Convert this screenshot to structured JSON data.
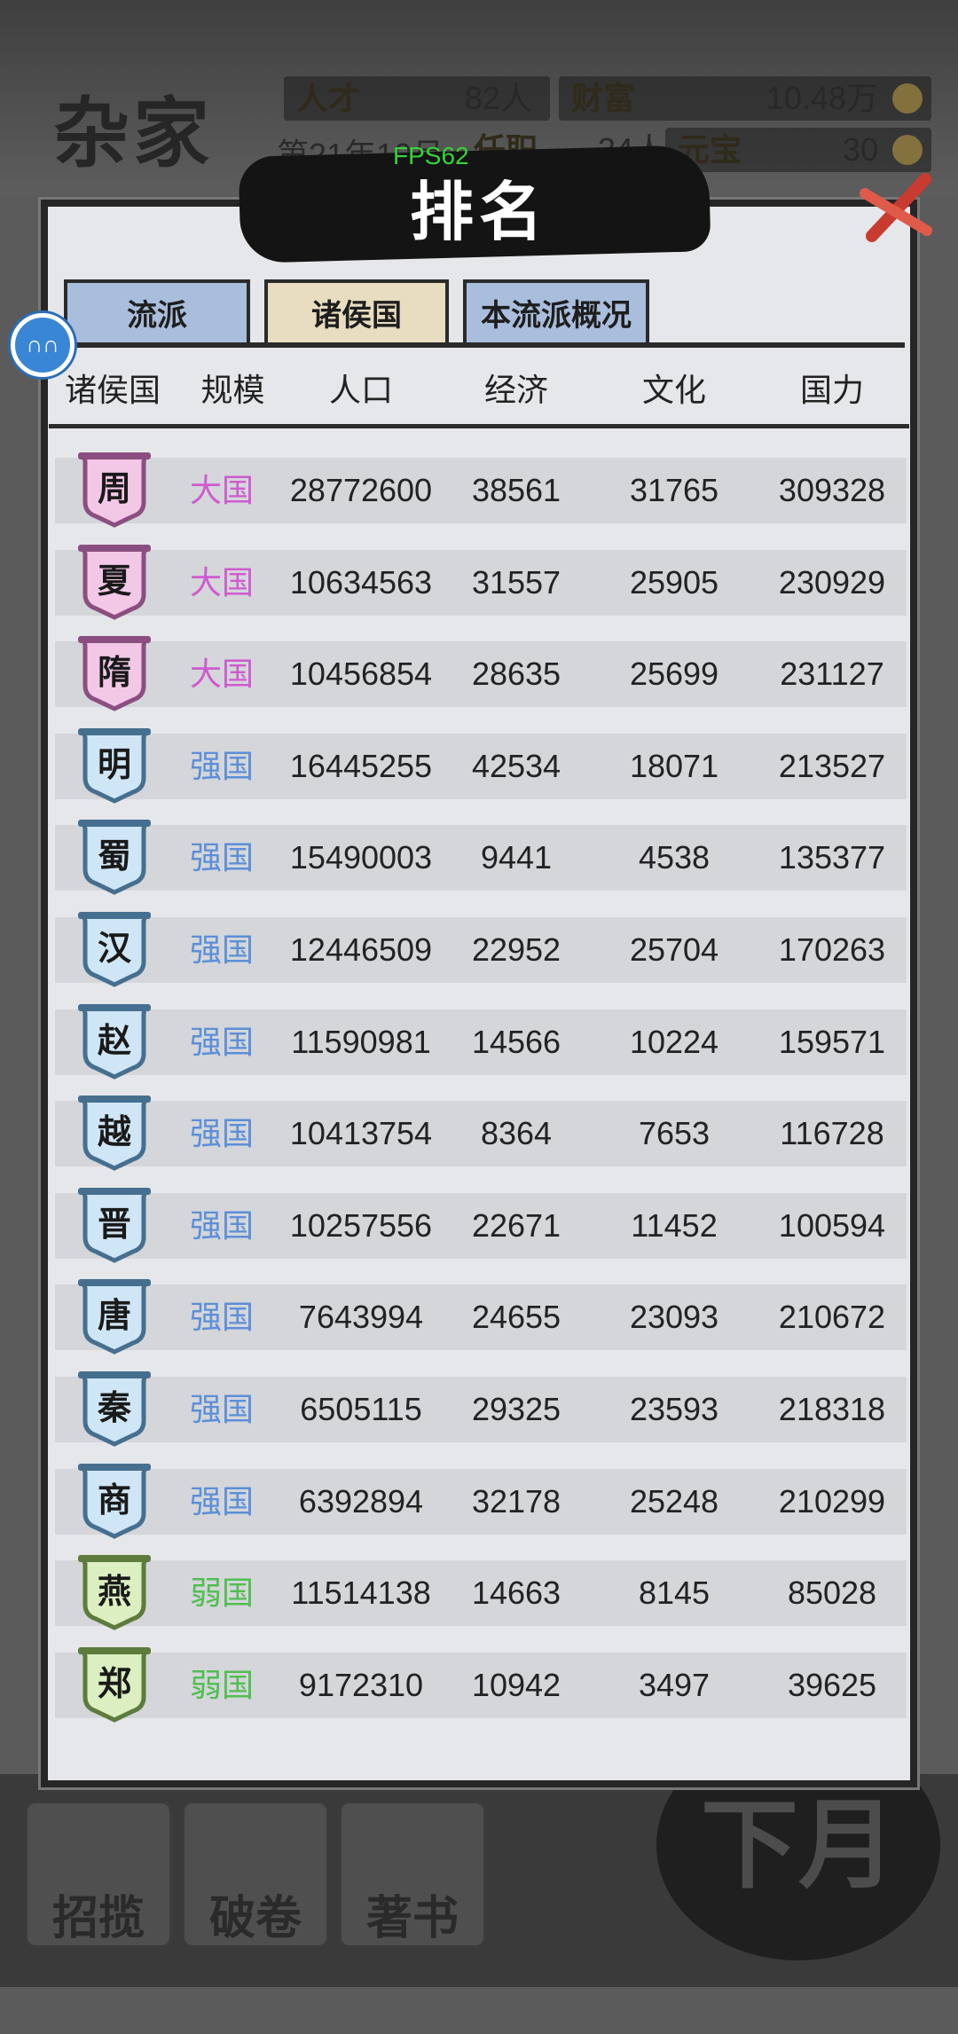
{
  "status": {
    "school_title": "杂家",
    "talent_label": "人才",
    "talent_value": "82人",
    "wealth_label": "财富",
    "wealth_value": "10.48万",
    "date": "第21年10月",
    "office_label": "任职",
    "office_value": "34人",
    "ingot_label": "元宝",
    "ingot_value": "30"
  },
  "fps": "FPS62",
  "panel": {
    "title": "排名",
    "tabs": [
      "流派",
      "诸侯国",
      "本流派概况"
    ],
    "active_tab": "诸侯国",
    "columns": [
      "诸侯国",
      "规模",
      "人口",
      "经济",
      "文化",
      "国力"
    ]
  },
  "colors": {
    "great": "#d05ad0",
    "strong": "#5b8fd8",
    "weak": "#4fbf4f"
  },
  "rows": [
    {
      "state": "周",
      "scale": "大国",
      "tier": "great",
      "pop": "28772600",
      "eco": "38561",
      "cul": "31765",
      "pow": "309328"
    },
    {
      "state": "夏",
      "scale": "大国",
      "tier": "great",
      "pop": "10634563",
      "eco": "31557",
      "cul": "25905",
      "pow": "230929"
    },
    {
      "state": "隋",
      "scale": "大国",
      "tier": "great",
      "pop": "10456854",
      "eco": "28635",
      "cul": "25699",
      "pow": "231127"
    },
    {
      "state": "明",
      "scale": "强国",
      "tier": "strong",
      "pop": "16445255",
      "eco": "42534",
      "cul": "18071",
      "pow": "213527"
    },
    {
      "state": "蜀",
      "scale": "强国",
      "tier": "strong",
      "pop": "15490003",
      "eco": "9441",
      "cul": "4538",
      "pow": "135377"
    },
    {
      "state": "汉",
      "scale": "强国",
      "tier": "strong",
      "pop": "12446509",
      "eco": "22952",
      "cul": "25704",
      "pow": "170263"
    },
    {
      "state": "赵",
      "scale": "强国",
      "tier": "strong",
      "pop": "11590981",
      "eco": "14566",
      "cul": "10224",
      "pow": "159571"
    },
    {
      "state": "越",
      "scale": "强国",
      "tier": "strong",
      "pop": "10413754",
      "eco": "8364",
      "cul": "7653",
      "pow": "116728"
    },
    {
      "state": "晋",
      "scale": "强国",
      "tier": "strong",
      "pop": "10257556",
      "eco": "22671",
      "cul": "11452",
      "pow": "100594"
    },
    {
      "state": "唐",
      "scale": "强国",
      "tier": "strong",
      "pop": "7643994",
      "eco": "24655",
      "cul": "23093",
      "pow": "210672"
    },
    {
      "state": "秦",
      "scale": "强国",
      "tier": "strong",
      "pop": "6505115",
      "eco": "29325",
      "cul": "23593",
      "pow": "218318"
    },
    {
      "state": "商",
      "scale": "强国",
      "tier": "strong",
      "pop": "6392894",
      "eco": "32178",
      "cul": "25248",
      "pow": "210299"
    },
    {
      "state": "燕",
      "scale": "弱国",
      "tier": "weak",
      "pop": "11514138",
      "eco": "14663",
      "cul": "8145",
      "pow": "85028"
    },
    {
      "state": "郑",
      "scale": "弱国",
      "tier": "weak",
      "pop": "9172310",
      "eco": "10942",
      "cul": "3497",
      "pow": "39625"
    }
  ],
  "bottom_buttons": [
    "招揽",
    "破卷",
    "著书"
  ],
  "next_month": "下月"
}
